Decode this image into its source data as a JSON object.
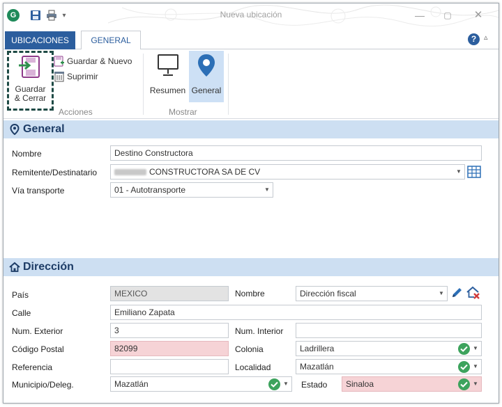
{
  "window": {
    "title": "Nueva ubicación",
    "app_logo_letter": "G"
  },
  "tabs": {
    "ubicaciones": "UBICACIONES",
    "general": "GENERAL"
  },
  "ribbon": {
    "guardar_cerrar_line1": "Guardar",
    "guardar_cerrar_line2": "& Cerrar",
    "guardar_nuevo": "Guardar & Nuevo",
    "suprimir": "Suprimir",
    "group_acciones": "Acciones",
    "resumen": "Resumen",
    "general": "General",
    "group_mostrar": "Mostrar"
  },
  "general_section": {
    "title": "General",
    "nombre_label": "Nombre",
    "nombre_value": "Destino Constructora",
    "remitente_label": "Remitente/Destinatario",
    "remitente_value": "CONSTRUCTORA SA DE CV",
    "via_label": "Vía transporte",
    "via_value": "01 - Autotransporte"
  },
  "direccion_section": {
    "title": "Dirección",
    "pais_label": "País",
    "pais_value": "MEXICO",
    "nombre_label": "Nombre",
    "nombre_value": "Dirección fiscal",
    "calle_label": "Calle",
    "calle_value": "Emiliano Zapata",
    "num_ext_label": "Num. Exterior",
    "num_ext_value": "3",
    "num_int_label": "Num. Interior",
    "num_int_value": "",
    "cp_label": "Código Postal",
    "cp_value": "82099",
    "colonia_label": "Colonia",
    "colonia_value": "Ladrillera",
    "referencia_label": "Referencia",
    "referencia_value": "",
    "localidad_label": "Localidad",
    "localidad_value": "Mazatlán",
    "municipio_label": "Municipio/Deleg.",
    "municipio_value": "Mazatlán",
    "estado_label": "Estado",
    "estado_value": "Sinaloa"
  },
  "colors": {
    "accent": "#2c5e9e",
    "section_header_bg": "#cddff2",
    "error_bg": "#f6d3d6",
    "ok_green": "#3da35d"
  }
}
